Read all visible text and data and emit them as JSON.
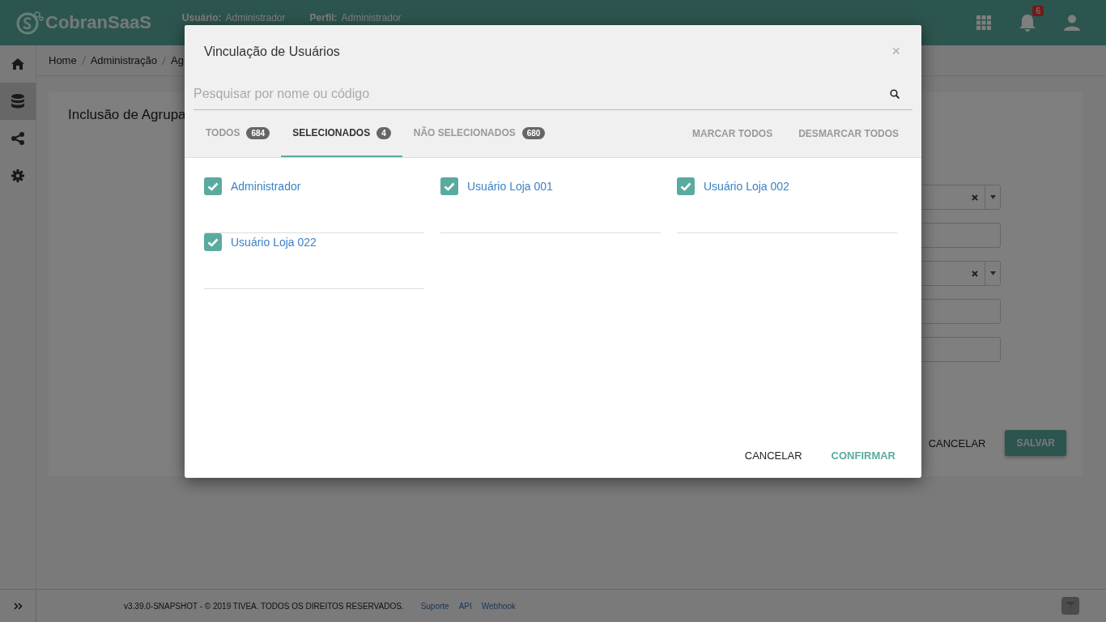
{
  "header": {
    "logo": "CobranSaaS",
    "user_label": "Usuário:",
    "user": "Administrador",
    "profile_label": "Perfil:",
    "profile": "Administrador",
    "notification_count": "6"
  },
  "sidebar": {
    "items": [
      {
        "kind": "home",
        "selected": false
      },
      {
        "kind": "database",
        "selected": true
      },
      {
        "kind": "share",
        "selected": false
      },
      {
        "kind": "settings",
        "selected": false
      }
    ]
  },
  "breadcrumb": [
    "Home",
    "Administração",
    "Ag"
  ],
  "page": {
    "title": "Inclusão de Agrupa",
    "fields": [
      {
        "kind": "select"
      },
      {
        "kind": "input"
      },
      {
        "kind": "select"
      },
      {
        "kind": "input"
      },
      {
        "kind": "input"
      }
    ],
    "cancel": "CANCELAR",
    "save": "SALVAR"
  },
  "footer": {
    "version": "v3.39.0-SNAPSHOT - © 2019 TIVEA. TODOS OS DIREITOS RESERVADOS.",
    "links": [
      "Suporte",
      "API",
      "Webhook"
    ]
  },
  "modal": {
    "title": "Vinculação de Usuários",
    "close": "×",
    "search": {
      "placeholder": "Pesquisar por nome ou código"
    },
    "tabs": [
      {
        "label": "TODOS",
        "count": "684",
        "selected": false
      },
      {
        "label": "SELECIONADOS",
        "count": "4",
        "selected": true
      },
      {
        "label": "NÃO SELECIONADOS",
        "count": "680",
        "selected": false
      }
    ],
    "actions": [
      "MARCAR TODOS",
      "DESMARCAR TODOS"
    ],
    "items": [
      {
        "label": "Administrador",
        "checked": true
      },
      {
        "label": "Usuário Loja 001",
        "checked": true
      },
      {
        "label": "Usuário Loja 002",
        "checked": true
      },
      {
        "label": "Usuário Loja 022",
        "checked": true
      }
    ],
    "cancel": "CANCELAR",
    "confirm": "CONFIRMAR"
  }
}
